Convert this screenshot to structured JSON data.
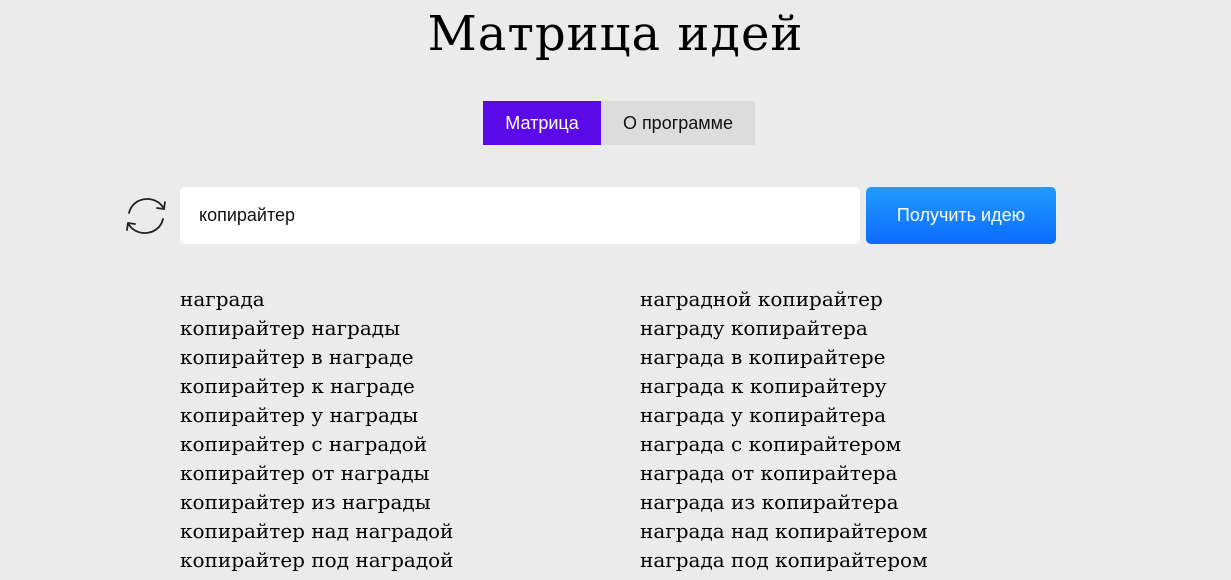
{
  "page": {
    "title": "Матрица идей"
  },
  "tabs": [
    {
      "label": "Матрица",
      "active": true
    },
    {
      "label": "О программе",
      "active": false
    }
  ],
  "search": {
    "value": "копирайтер",
    "refresh_icon": "refresh-icon",
    "submit_label": "Получить идею"
  },
  "colors": {
    "background": "#ebebeb",
    "active_tab": "#5b0be8",
    "inactive_tab": "#dcdcdc",
    "button": "#1683ff"
  },
  "results": {
    "left": [
      "награда",
      "копирайтер награды",
      "копирайтер в награде",
      "копирайтер к награде",
      "копирайтер у награды",
      "копирайтер с наградой",
      "копирайтер от награды",
      "копирайтер из награды",
      "копирайтер над наградой",
      "копирайтер под наградой"
    ],
    "right": [
      "наградной копирайтер",
      "награду копирайтера",
      "награда в копирайтере",
      "награда к копирайтеру",
      "награда у копирайтера",
      "награда с копирайтером",
      "награда от копирайтера",
      "награда из копирайтера",
      "награда над копирайтером",
      "награда под копирайтером"
    ]
  }
}
